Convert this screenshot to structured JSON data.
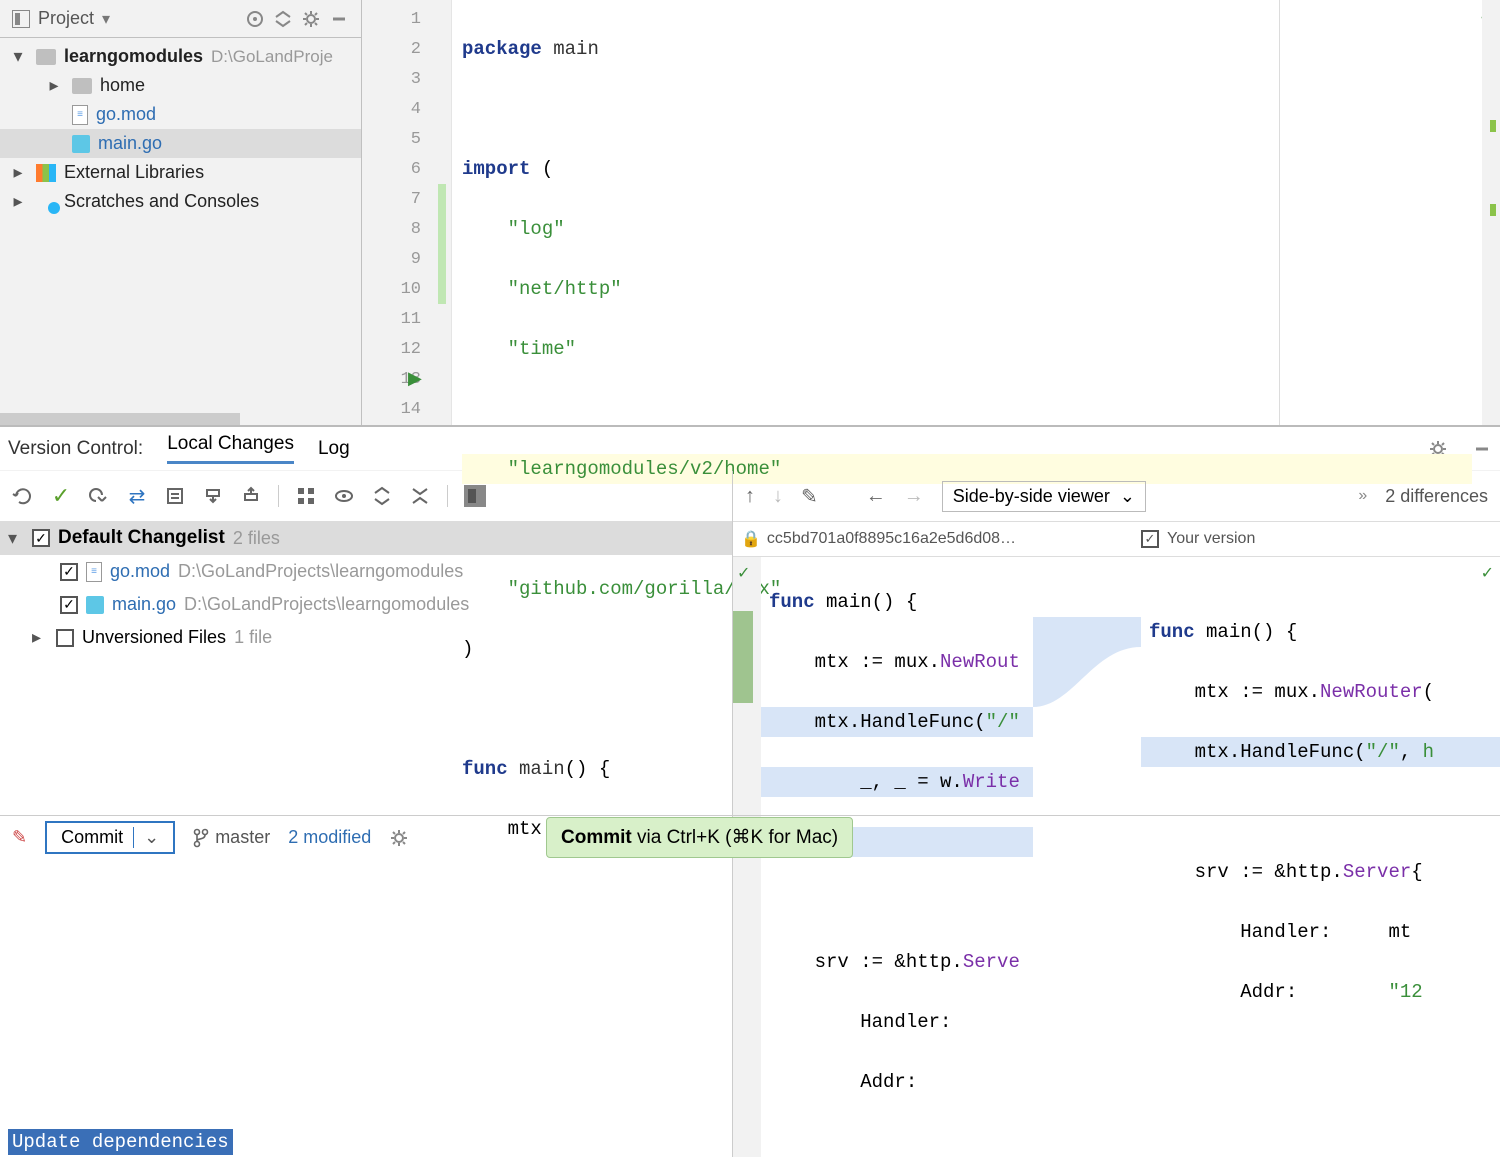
{
  "sidebar": {
    "title": "Project",
    "project_name": "learngomodules",
    "project_path": "D:\\GoLandProje",
    "items": [
      {
        "name": "home",
        "type": "folder"
      },
      {
        "name": "go.mod",
        "type": "file"
      },
      {
        "name": "main.go",
        "type": "go"
      }
    ],
    "external": "External Libraries",
    "scratches": "Scratches and Consoles"
  },
  "editor": {
    "lines": [
      "package main",
      "",
      "import (",
      "    \"log\"",
      "    \"net/http\"",
      "    \"time\"",
      "",
      "    \"learngomodules/v2/home\"",
      "",
      "    \"github.com/gorilla/mux\"",
      ")",
      "",
      "func main() {",
      "    mtx := mux.NewRouter()"
    ]
  },
  "vc": {
    "label": "Version Control:",
    "tabs": [
      "Local Changes",
      "Log"
    ],
    "changelist": {
      "name": "Default Changelist",
      "count": "2 files",
      "files": [
        {
          "name": "go.mod",
          "path": "D:\\GoLandProjects\\learngomodules"
        },
        {
          "name": "main.go",
          "path": "D:\\GoLandProjects\\learngomodules"
        }
      ]
    },
    "unversioned": {
      "label": "Unversioned Files",
      "count": "1 file"
    },
    "commit_message": "Update dependencies"
  },
  "diff": {
    "viewer_mode": "Side-by-side viewer",
    "diff_count": "2 differences",
    "left_label": "cc5bd701a0f8895c16a2e5d6d08…",
    "right_label": "Your version",
    "left_code": [
      "func main() {",
      "    mtx := mux.NewRout",
      "    mtx.HandleFunc(\"/\"",
      "        _, _ = w.Write",
      "    })",
      "",
      "    srv := &http.Serve",
      "        Handler:     ",
      "        Addr:"
    ],
    "right_code": [
      "func main() {",
      "    mtx := mux.NewRouter(",
      "    mtx.HandleFunc(\"/\", h",
      "",
      "    srv := &http.Server{",
      "        Handler:     mt",
      "        Addr:        \"12"
    ]
  },
  "footer": {
    "commit_label": "Commit",
    "branch": "master",
    "modified": "2 modified",
    "hint_bold": "Commit",
    "hint_rest": " via Ctrl+K (⌘K for Mac)"
  }
}
